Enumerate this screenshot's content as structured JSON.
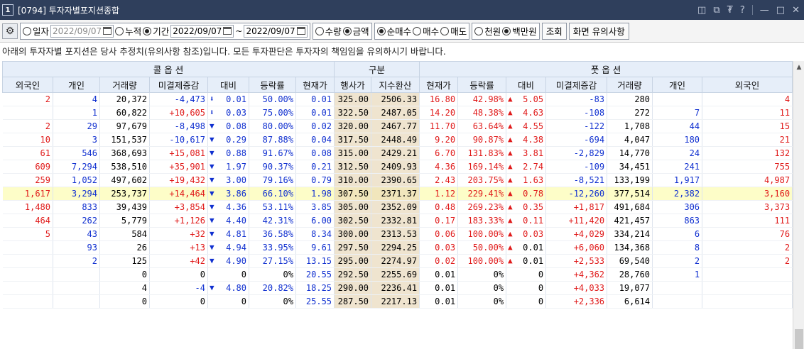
{
  "window": {
    "number": "1",
    "title": "[0794] 투자자별포지션종합",
    "icons": [
      "◫",
      "⧉",
      "₮",
      "?",
      "—",
      "□",
      "✕"
    ]
  },
  "toolbar": {
    "period_mode": [
      {
        "label": "일자",
        "selected": false
      },
      {
        "label": "누적",
        "selected": false
      },
      {
        "label": "기간",
        "selected": true
      }
    ],
    "date_single": "2022/09/07",
    "date_from": "2022/09/07",
    "date_tilde": "~",
    "date_to": "2022/09/07",
    "unit_mode": [
      {
        "label": "수량",
        "selected": false
      },
      {
        "label": "금액",
        "selected": true
      }
    ],
    "trade_mode": [
      {
        "label": "순매수",
        "selected": true
      },
      {
        "label": "매수",
        "selected": false
      },
      {
        "label": "매도",
        "selected": false
      }
    ],
    "money_unit": [
      {
        "label": "천원",
        "selected": false
      },
      {
        "label": "백만원",
        "selected": true
      }
    ],
    "search_label": "조회",
    "caution_label": "화면 유의사항"
  },
  "notice": "아래의 투자자별 포지션은 당사 추정치(유의사항 참조)입니다. 모든 투자판단은 투자자의 책임임을 유의하시기 바랍니다.",
  "headers": {
    "call_group": "콜 옵 션",
    "mid_group": "구분",
    "put_group": "풋 옵 션",
    "columns": [
      "외국인",
      "개인",
      "거래량",
      "미결제증감",
      "대비",
      "등락률",
      "현재가",
      "행사가",
      "지수환산",
      "현재가",
      "등락률",
      "대비",
      "미결제증감",
      "거래량",
      "개인",
      "외국인"
    ]
  },
  "rows": [
    {
      "c_frgn": "2",
      "c_indv": "4",
      "c_vol": "20,372",
      "c_oi": "-4,473",
      "c_arrow": "down-small",
      "c_diff": "0.01",
      "c_rate": "50.00%",
      "c_px": "0.01",
      "strike": "325.00",
      "index": "2506.33",
      "p_px": "16.80",
      "p_rate": "42.98%",
      "p_arrow": "up",
      "p_diff": "5.05",
      "p_oi": "-83",
      "p_vol": "280",
      "p_indv": "",
      "p_frgn": "4"
    },
    {
      "c_frgn": "",
      "c_indv": "1",
      "c_vol": "60,822",
      "c_oi": "+10,605",
      "c_arrow": "down-small",
      "c_diff": "0.03",
      "c_rate": "75.00%",
      "c_px": "0.01",
      "strike": "322.50",
      "index": "2487.05",
      "p_px": "14.20",
      "p_rate": "48.38%",
      "p_arrow": "up",
      "p_diff": "4.63",
      "p_oi": "-108",
      "p_vol": "272",
      "p_indv": "7",
      "p_frgn": "11"
    },
    {
      "c_frgn": "2",
      "c_indv": "29",
      "c_vol": "97,679",
      "c_oi": "-8,498",
      "c_arrow": "down",
      "c_diff": "0.08",
      "c_rate": "80.00%",
      "c_px": "0.02",
      "strike": "320.00",
      "index": "2467.77",
      "p_px": "11.70",
      "p_rate": "63.64%",
      "p_arrow": "up",
      "p_diff": "4.55",
      "p_oi": "-122",
      "p_vol": "1,708",
      "p_indv": "44",
      "p_frgn": "15"
    },
    {
      "c_frgn": "10",
      "c_indv": "3",
      "c_vol": "151,537",
      "c_oi": "-10,617",
      "c_arrow": "down",
      "c_diff": "0.29",
      "c_rate": "87.88%",
      "c_px": "0.04",
      "strike": "317.50",
      "index": "2448.49",
      "p_px": "9.20",
      "p_rate": "90.87%",
      "p_arrow": "up",
      "p_diff": "4.38",
      "p_oi": "-694",
      "p_vol": "4,047",
      "p_indv": "180",
      "p_frgn": "21"
    },
    {
      "c_frgn": "61",
      "c_indv": "546",
      "c_vol": "368,693",
      "c_oi": "+15,081",
      "c_arrow": "down",
      "c_diff": "0.88",
      "c_rate": "91.67%",
      "c_px": "0.08",
      "strike": "315.00",
      "index": "2429.21",
      "p_px": "6.70",
      "p_rate": "131.83%",
      "p_arrow": "up",
      "p_diff": "3.81",
      "p_oi": "-2,829",
      "p_vol": "14,770",
      "p_indv": "24",
      "p_frgn": "132"
    },
    {
      "c_frgn": "609",
      "c_indv": "7,294",
      "c_vol": "538,510",
      "c_oi": "+35,901",
      "c_arrow": "down",
      "c_diff": "1.97",
      "c_rate": "90.37%",
      "c_px": "0.21",
      "strike": "312.50",
      "index": "2409.93",
      "p_px": "4.36",
      "p_rate": "169.14%",
      "p_arrow": "up",
      "p_diff": "2.74",
      "p_oi": "-109",
      "p_vol": "34,451",
      "p_indv": "241",
      "p_frgn": "755"
    },
    {
      "c_frgn": "259",
      "c_indv": "1,052",
      "c_vol": "497,602",
      "c_oi": "+19,432",
      "c_arrow": "down",
      "c_diff": "3.00",
      "c_rate": "79.16%",
      "c_px": "0.79",
      "strike": "310.00",
      "index": "2390.65",
      "p_px": "2.43",
      "p_rate": "203.75%",
      "p_arrow": "up",
      "p_diff": "1.63",
      "p_oi": "-8,521",
      "p_vol": "133,199",
      "p_indv": "1,917",
      "p_frgn": "4,987"
    },
    {
      "c_frgn": "1,617",
      "c_indv": "3,294",
      "c_vol": "253,737",
      "c_oi": "+14,464",
      "c_arrow": "down",
      "c_diff": "3.86",
      "c_rate": "66.10%",
      "c_px": "1.98",
      "strike": "307.50",
      "index": "2371.37",
      "p_px": "1.12",
      "p_rate": "229.41%",
      "p_arrow": "up",
      "p_diff": "0.78",
      "p_oi": "-12,260",
      "p_vol": "377,514",
      "p_indv": "2,382",
      "p_frgn": "3,160",
      "highlight": true
    },
    {
      "c_frgn": "1,480",
      "c_indv": "833",
      "c_vol": "39,439",
      "c_oi": "+3,854",
      "c_arrow": "down",
      "c_diff": "4.36",
      "c_rate": "53.11%",
      "c_px": "3.85",
      "strike": "305.00",
      "index": "2352.09",
      "p_px": "0.48",
      "p_rate": "269.23%",
      "p_arrow": "up",
      "p_diff": "0.35",
      "p_oi": "+1,817",
      "p_vol": "491,684",
      "p_indv": "306",
      "p_frgn": "3,373"
    },
    {
      "c_frgn": "464",
      "c_indv": "262",
      "c_vol": "5,779",
      "c_oi": "+1,126",
      "c_arrow": "down",
      "c_diff": "4.40",
      "c_rate": "42.31%",
      "c_px": "6.00",
      "strike": "302.50",
      "index": "2332.81",
      "p_px": "0.17",
      "p_rate": "183.33%",
      "p_arrow": "up",
      "p_diff": "0.11",
      "p_oi": "+11,420",
      "p_vol": "421,457",
      "p_indv": "863",
      "p_frgn": "111"
    },
    {
      "c_frgn": "5",
      "c_indv": "43",
      "c_vol": "584",
      "c_oi": "+32",
      "c_arrow": "down",
      "c_diff": "4.81",
      "c_rate": "36.58%",
      "c_px": "8.34",
      "strike": "300.00",
      "index": "2313.53",
      "p_px": "0.06",
      "p_rate": "100.00%",
      "p_arrow": "up",
      "p_diff": "0.03",
      "p_oi": "+4,029",
      "p_vol": "334,214",
      "p_indv": "6",
      "p_frgn": "76"
    },
    {
      "c_frgn": "",
      "c_indv": "93",
      "c_vol": "26",
      "c_oi": "+13",
      "c_arrow": "down",
      "c_diff": "4.94",
      "c_rate": "33.95%",
      "c_px": "9.61",
      "strike": "297.50",
      "index": "2294.25",
      "p_px": "0.03",
      "p_rate": "50.00%",
      "p_arrow": "up",
      "p_diff": "0.01",
      "p_oi": "+6,060",
      "p_vol": "134,368",
      "p_indv": "8",
      "p_frgn": "2"
    },
    {
      "c_frgn": "",
      "c_indv": "2",
      "c_vol": "125",
      "c_oi": "+42",
      "c_arrow": "down",
      "c_diff": "4.90",
      "c_rate": "27.15%",
      "c_px": "13.15",
      "strike": "295.00",
      "index": "2274.97",
      "p_px": "0.02",
      "p_rate": "100.00%",
      "p_arrow": "up",
      "p_diff": "0.01",
      "p_oi": "+2,533",
      "p_vol": "69,540",
      "p_indv": "2",
      "p_frgn": "2"
    },
    {
      "c_frgn": "",
      "c_indv": "",
      "c_vol": "0",
      "c_oi": "0",
      "c_arrow": "",
      "c_diff": "0",
      "c_rate": "0%",
      "c_px": "20.55",
      "strike": "292.50",
      "index": "2255.69",
      "p_px": "0.01",
      "p_rate": "0%",
      "p_arrow": "",
      "p_diff": "0",
      "p_oi": "+4,362",
      "p_vol": "28,760",
      "p_indv": "1",
      "p_frgn": ""
    },
    {
      "c_frgn": "",
      "c_indv": "",
      "c_vol": "4",
      "c_oi": "-4",
      "c_arrow": "down",
      "c_diff": "4.80",
      "c_rate": "20.82%",
      "c_px": "18.25",
      "strike": "290.00",
      "index": "2236.41",
      "p_px": "0.01",
      "p_rate": "0%",
      "p_arrow": "",
      "p_diff": "0",
      "p_oi": "+4,033",
      "p_vol": "19,077",
      "p_indv": "",
      "p_frgn": ""
    },
    {
      "c_frgn": "",
      "c_indv": "",
      "c_vol": "0",
      "c_oi": "0",
      "c_arrow": "",
      "c_diff": "0",
      "c_rate": "0%",
      "c_px": "25.55",
      "strike": "287.50",
      "index": "2217.13",
      "p_px": "0.01",
      "p_rate": "0%",
      "p_arrow": "",
      "p_diff": "0",
      "p_oi": "+2,336",
      "p_vol": "6,614",
      "p_indv": "",
      "p_frgn": ""
    }
  ],
  "colors": {
    "titlebar": "#2f3f5c",
    "header": "#e6eef9",
    "strike_bg": "#efe4cf",
    "highlight_row": "#fdfdc8",
    "up": "#e01a1a",
    "down": "#1030d0"
  }
}
